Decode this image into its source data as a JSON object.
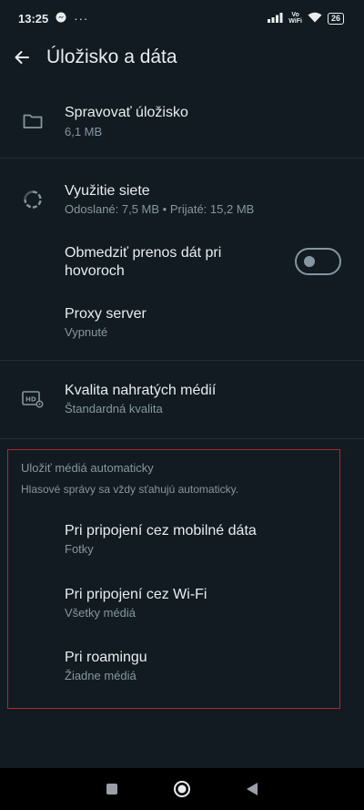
{
  "status_bar": {
    "time": "13:25",
    "dots": "···",
    "vo_wifi_line1": "Vo",
    "vo_wifi_line2": "WiFi",
    "battery": "26"
  },
  "app_bar": {
    "title": "Úložisko a dáta",
    "back_icon": "arrow-left-icon"
  },
  "rows": {
    "manage_storage": {
      "title": "Spravovať úložisko",
      "subtitle": "6,1 MB",
      "icon": "folder-icon"
    },
    "network_usage": {
      "title": "Využitie siete",
      "subtitle": "Odoslané: 7,5 MB • Prijaté: 15,2 MB",
      "icon": "data-usage-icon"
    },
    "limit_calls": {
      "title_line1": "Obmedziť prenos dát pri",
      "title_line2": "hovoroch",
      "toggle_on": false
    },
    "proxy": {
      "title": "Proxy server",
      "subtitle": "Vypnuté"
    },
    "media_quality": {
      "title": "Kvalita nahratých médií",
      "subtitle": "Štandardná kvalita",
      "icon": "hd-settings-icon"
    }
  },
  "auto_download": {
    "header": "Uložiť médiá automaticky",
    "note": "Hlasové správy sa vždy sťahujú automaticky.",
    "items": [
      {
        "title": "Pri pripojení cez mobilné dáta",
        "subtitle": "Fotky"
      },
      {
        "title": "Pri pripojení cez Wi-Fi",
        "subtitle": "Všetky médiá"
      },
      {
        "title": "Pri roamingu",
        "subtitle": "Žiadne médiá"
      }
    ]
  },
  "colors": {
    "background": "#111b21",
    "primary_text": "#e9edef",
    "secondary_text": "#8696a0",
    "highlight_border": "#b3262e"
  }
}
